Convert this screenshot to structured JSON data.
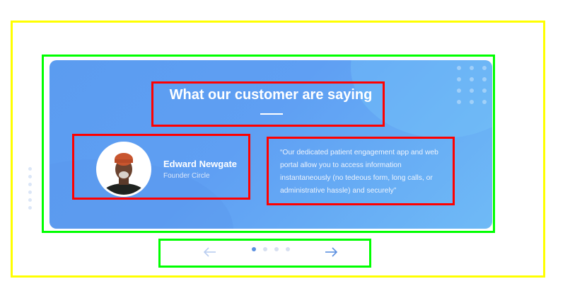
{
  "testimonial": {
    "title": "What our customer are saying",
    "author_name": "Edward Newgate",
    "author_role": "Founder Circle",
    "quote": "“Our dedicated patient engagement app and web portal allow you to access information instantaneously (no tedeous form, long calls, or administrative hassle) and securely”"
  },
  "carousel": {
    "dot_count": 4,
    "active_index": 0,
    "prev_icon": "arrow-left-icon",
    "next_icon": "arrow-right-icon"
  },
  "colors": {
    "card_blue": "#5b9cf0",
    "card_light": "#6fbaf6",
    "active_dot": "#5b8fe0",
    "next_arrow": "#5b8fe0",
    "prev_arrow": "#b9cdf0"
  }
}
